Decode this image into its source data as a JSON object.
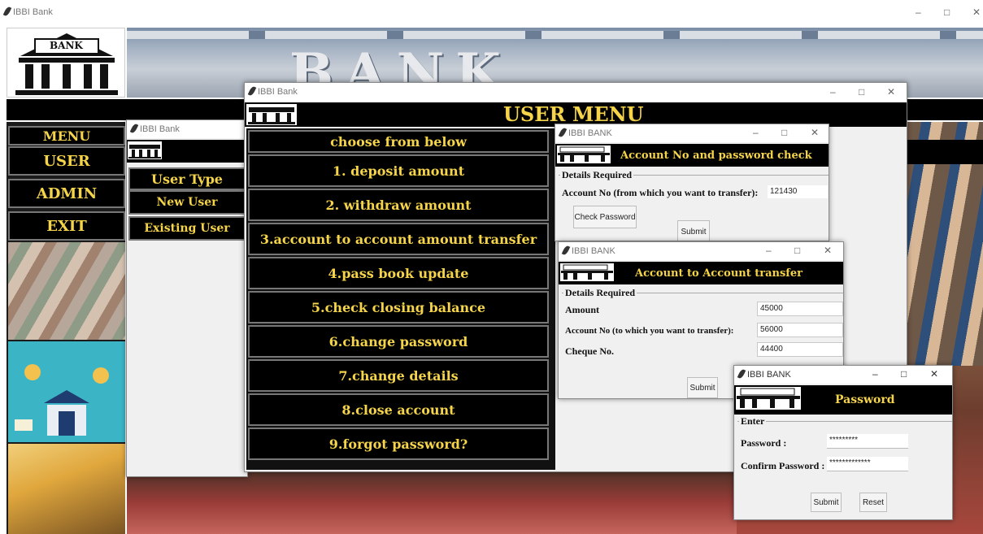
{
  "main": {
    "title": "IBBI Bank",
    "banner_text": "BANK",
    "logo_text": "BANK",
    "controls": [
      "–",
      "□",
      "✕"
    ],
    "menu_heading": "MENU",
    "menu_items": [
      "USER",
      "ADMIN",
      "EXIT"
    ]
  },
  "user_type_win": {
    "title": "IBBI Bank",
    "logo_text": "BANK",
    "heading": "User Type",
    "options": [
      "New User",
      "Existing User"
    ]
  },
  "user_menu_win": {
    "title": "IBBI Bank",
    "logo_text": "BANK",
    "heading": "USER MENU",
    "subheading": "choose from below",
    "controls": [
      "–",
      "□",
      "✕"
    ],
    "items": [
      "1. deposit amount",
      "2. withdraw amount",
      "3.account to account amount transfer",
      "4.pass book update",
      "5.check closing balance",
      "6.change password",
      "7.change details",
      "8.close account",
      "9.forgot password?"
    ]
  },
  "acct_check_win": {
    "title": "IBBI BANK",
    "logo_text": "BANK",
    "heading": "Account No and password check",
    "group": "Details Required",
    "account_label": "Account No (from which you want to transfer):",
    "account_value": "121430",
    "check_button": "Check Password",
    "submit_button": "Submit",
    "controls": [
      "–",
      "□",
      "✕"
    ]
  },
  "transfer_win": {
    "title": "IBBI BANK",
    "logo_text": "BANK",
    "heading": "Account to Account transfer",
    "group": "Details Required",
    "amount_label": "Amount",
    "amount_value": "45000",
    "to_account_label": "Account No (to which you want to transfer):",
    "to_account_value": "56000",
    "cheque_label": "Cheque No.",
    "cheque_value": "44400",
    "submit_button": "Submit",
    "controls": [
      "–",
      "□",
      "✕"
    ]
  },
  "password_win": {
    "title": "IBBI BANK",
    "logo_text": "BANK",
    "heading": "Password",
    "group": "Enter",
    "password_label": "Password :",
    "password_value": "*********",
    "confirm_label": "Confirm Password :",
    "confirm_value": "*************",
    "submit_button": "Submit",
    "reset_button": "Reset",
    "controls": [
      "–",
      "□",
      "✕"
    ]
  },
  "colors": {
    "menu_text": "#f5d44a",
    "heading_bar": "#000000"
  }
}
